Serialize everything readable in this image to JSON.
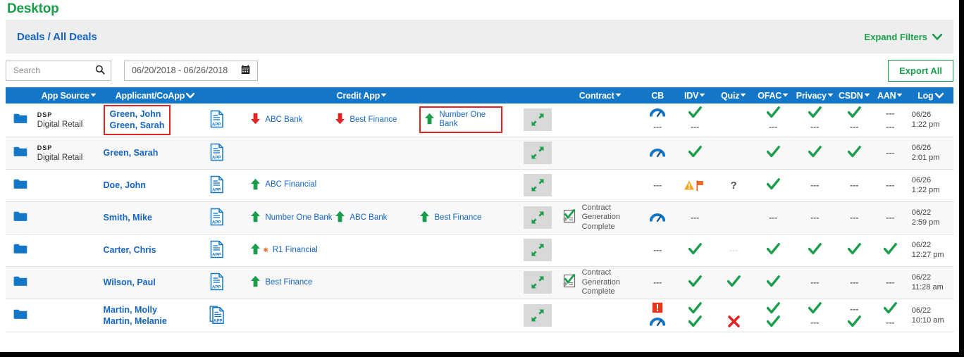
{
  "page": {
    "title": "Desktop"
  },
  "filters": {
    "breadcrumb": "Deals / All Deals",
    "expand_label": "Expand Filters",
    "chevron": "⌄"
  },
  "controls": {
    "search_placeholder": "Search",
    "search_value": "",
    "date_range": "06/20/2018 - 06/26/2018",
    "export_label": "Export All"
  },
  "columns": [
    {
      "key": "folder",
      "label": "",
      "caret": ""
    },
    {
      "key": "app_source",
      "label": "App Source",
      "caret": "▾"
    },
    {
      "key": "applicant",
      "label": "Applicant/CoApp",
      "caret": "⌄"
    },
    {
      "key": "credit_app",
      "label": "Credit App",
      "caret": "▾"
    },
    {
      "key": "expand",
      "label": "",
      "caret": ""
    },
    {
      "key": "contract",
      "label": "Contract",
      "caret": "▾"
    },
    {
      "key": "cb",
      "label": "CB",
      "caret": ""
    },
    {
      "key": "idv",
      "label": "IDV",
      "caret": "▾"
    },
    {
      "key": "quiz",
      "label": "Quiz",
      "caret": "▾"
    },
    {
      "key": "ofac",
      "label": "OFAC",
      "caret": "▾"
    },
    {
      "key": "privacy",
      "label": "Privacy",
      "caret": "▾"
    },
    {
      "key": "csdn",
      "label": "CSDN",
      "caret": "▾"
    },
    {
      "key": "aan",
      "label": "AAN",
      "caret": "▾"
    },
    {
      "key": "log",
      "label": "Log",
      "caret": "⌄"
    }
  ],
  "colors": {
    "header_blue": "#1476c6",
    "link_blue": "#1565c0",
    "green": "#1a9e4b",
    "red": "#e02424",
    "amber": "#f5a623",
    "orange": "#f06a2a",
    "title_green": "#1a9e4b"
  },
  "rows": [
    {
      "folder_icon": "folder-icon",
      "app_source_tag": "DSP",
      "app_source_sub": "Digital Retail",
      "applicants": [
        "Green, John",
        "Green, Sarah"
      ],
      "applicant_highlighted": true,
      "credit_app_doc": "app-document-icon",
      "lenders": [
        {
          "name": "ABC Bank",
          "direction": "down",
          "highlighted": false,
          "star": false
        },
        {
          "name": "Best Finance",
          "direction": "down",
          "highlighted": false,
          "star": false
        },
        {
          "name": "Number One Bank",
          "direction": "up",
          "highlighted": true,
          "star": false
        }
      ],
      "contract": {
        "status": "",
        "icon": ""
      },
      "statuses": {
        "cb": [
          "gauge",
          "dash"
        ],
        "idv": [
          "check",
          "dash"
        ],
        "quiz": [
          "",
          ""
        ],
        "ofac": [
          "check",
          "dash"
        ],
        "privacy": [
          "check",
          "dash"
        ],
        "csdn": [
          "check",
          "dash"
        ],
        "aan": [
          "dash",
          "dash"
        ]
      },
      "log_date": "06/26",
      "log_time": "1:22 pm"
    },
    {
      "folder_icon": "folder-icon",
      "app_source_tag": "DSP",
      "app_source_sub": "Digital Retail",
      "applicants": [
        "Green, Sarah"
      ],
      "applicant_highlighted": false,
      "credit_app_doc": "app-document-icon",
      "lenders": [],
      "contract": {
        "status": "",
        "icon": ""
      },
      "statuses": {
        "cb": [
          "gauge"
        ],
        "idv": [
          "check"
        ],
        "quiz": [
          ""
        ],
        "ofac": [
          "check"
        ],
        "privacy": [
          "check"
        ],
        "csdn": [
          "check"
        ],
        "aan": [
          "dash"
        ]
      },
      "log_date": "06/26",
      "log_time": "2:01 pm"
    },
    {
      "folder_icon": "folder-icon",
      "app_source_tag": "",
      "app_source_sub": "",
      "applicants": [
        "Doe, John"
      ],
      "applicant_highlighted": false,
      "credit_app_doc": "app-document-icon",
      "lenders": [
        {
          "name": "ABC Financial",
          "direction": "up",
          "highlighted": false,
          "star": false
        }
      ],
      "contract": {
        "status": "",
        "icon": ""
      },
      "statuses": {
        "cb": [
          "dash"
        ],
        "idv": [
          "warning-flag"
        ],
        "quiz": [
          "question"
        ],
        "ofac": [
          "check"
        ],
        "privacy": [
          "dash"
        ],
        "csdn": [
          "dash"
        ],
        "aan": [
          "dash"
        ]
      },
      "log_date": "06/26",
      "log_time": "1:22 pm"
    },
    {
      "folder_icon": "folder-icon",
      "app_source_tag": "",
      "app_source_sub": "",
      "applicants": [
        "Smith, Mike"
      ],
      "applicant_highlighted": false,
      "credit_app_doc": "app-document-icon",
      "lenders": [
        {
          "name": "Number One Bank",
          "direction": "up",
          "highlighted": false,
          "star": false
        },
        {
          "name": "ABC Bank",
          "direction": "up",
          "highlighted": false,
          "star": false
        },
        {
          "name": "Best Finance",
          "direction": "up",
          "highlighted": false,
          "star": false
        }
      ],
      "contract": {
        "status": "Contract Generation Complete",
        "icon": "contract-check-icon"
      },
      "statuses": {
        "cb": [
          "gauge"
        ],
        "idv": [
          "dash"
        ],
        "quiz": [
          ""
        ],
        "ofac": [
          "dash"
        ],
        "privacy": [
          "dash"
        ],
        "csdn": [
          "dash"
        ],
        "aan": [
          "dash"
        ]
      },
      "log_date": "06/22",
      "log_time": "2:59 pm"
    },
    {
      "folder_icon": "folder-icon",
      "app_source_tag": "",
      "app_source_sub": "",
      "applicants": [
        "Carter, Chris"
      ],
      "applicant_highlighted": false,
      "credit_app_doc": "app-document-icon",
      "lenders": [
        {
          "name": "R1 Financial",
          "direction": "up",
          "highlighted": false,
          "star": true
        }
      ],
      "contract": {
        "status": "",
        "icon": ""
      },
      "statuses": {
        "cb": [
          "dash"
        ],
        "idv": [
          "check"
        ],
        "quiz": [
          "dash-faint"
        ],
        "ofac": [
          "check"
        ],
        "privacy": [
          "check"
        ],
        "csdn": [
          "check"
        ],
        "aan": [
          "check"
        ]
      },
      "log_date": "06/22",
      "log_time": "12:27 pm"
    },
    {
      "folder_icon": "folder-icon",
      "app_source_tag": "",
      "app_source_sub": "",
      "applicants": [
        "Wilson, Paul"
      ],
      "applicant_highlighted": false,
      "credit_app_doc": "app-document-icon",
      "lenders": [
        {
          "name": "Best Finance",
          "direction": "up",
          "highlighted": false,
          "star": false
        }
      ],
      "contract": {
        "status": "Contract Generation Complete",
        "icon": "contract-check-icon"
      },
      "statuses": {
        "cb": [
          "dash"
        ],
        "idv": [
          "check"
        ],
        "quiz": [
          "check"
        ],
        "ofac": [
          "check"
        ],
        "privacy": [
          "dash"
        ],
        "csdn": [
          "dash"
        ],
        "aan": [
          "dash"
        ]
      },
      "log_date": "06/22",
      "log_time": "11:28 am"
    },
    {
      "folder_icon": "folder-icon",
      "app_source_tag": "",
      "app_source_sub": "",
      "applicants": [
        "Martin, Molly",
        "Martin, Melanie"
      ],
      "applicant_highlighted": false,
      "credit_app_doc": "app-document-stack-icon",
      "lenders": [],
      "contract": {
        "status": "",
        "icon": ""
      },
      "statuses": {
        "cb": [
          "alert",
          "gauge"
        ],
        "idv": [
          "check",
          "check"
        ],
        "quiz": [
          "",
          "xmark"
        ],
        "ofac": [
          "check",
          "check"
        ],
        "privacy": [
          "check",
          "dash"
        ],
        "csdn": [
          "dash",
          "check"
        ],
        "aan": [
          "check",
          "dash"
        ]
      },
      "log_date": "06/22",
      "log_time": "10:10 am"
    }
  ]
}
